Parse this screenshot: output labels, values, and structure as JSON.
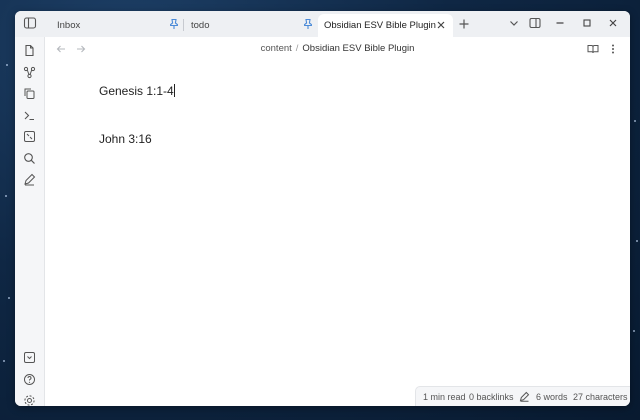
{
  "tabs": [
    {
      "label": "Inbox",
      "pinned": true,
      "active": false
    },
    {
      "label": "todo",
      "pinned": true,
      "active": false
    },
    {
      "label": "Obsidian ESV Bible Plugin",
      "pinned": false,
      "active": true
    }
  ],
  "breadcrumb": {
    "folder": "content",
    "separator": "/",
    "current": "Obsidian ESV Bible Plugin"
  },
  "editor": {
    "lines": [
      "Genesis 1:1-4",
      "John 3:16"
    ]
  },
  "status": {
    "read_time": "1 min read",
    "backlinks": "0 backlinks",
    "words": "6 words",
    "characters": "27 characters"
  },
  "colors": {
    "accent": "#4a8ad8",
    "titlebar": "#eef0f3",
    "ribbon": "#f5f6f8"
  },
  "icons": {
    "left_ribbon": [
      "files-icon",
      "graph-icon",
      "copy-icon",
      "terminal-icon",
      "canvas-icon",
      "search-icon",
      "pencil-icon"
    ],
    "left_ribbon_bottom": [
      "vault-icon",
      "help-icon",
      "settings-icon"
    ]
  }
}
